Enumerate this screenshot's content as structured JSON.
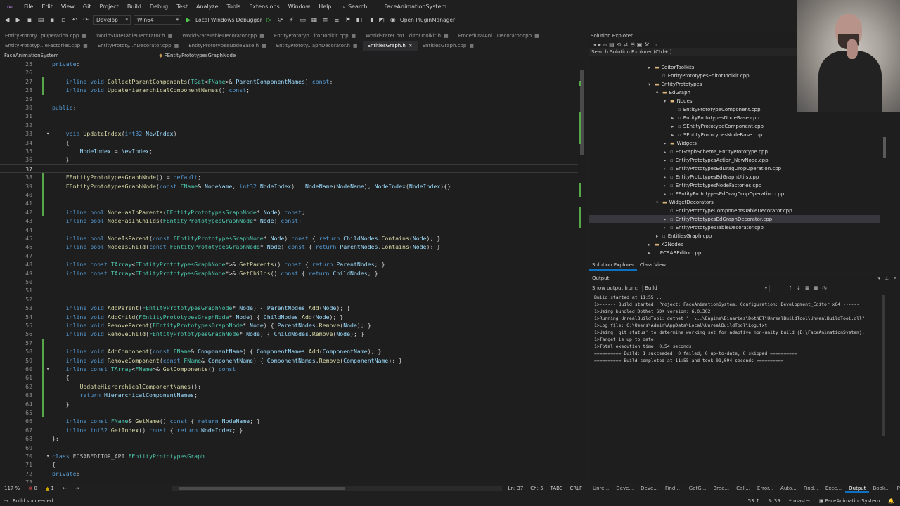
{
  "menu": {
    "items": [
      "File",
      "Edit",
      "View",
      "Git",
      "Project",
      "Build",
      "Debug",
      "Test",
      "Analyze",
      "Tools",
      "Extensions",
      "Window",
      "Help"
    ],
    "search_label": "Search",
    "app_title": "FaceAnimationSystem"
  },
  "toolbar": {
    "config": "Develop",
    "platform": "Win64",
    "debugger": "Local Windows Debugger",
    "plugin_manager": "Open PluginManager"
  },
  "tabs": {
    "row1": [
      {
        "label": "EntityPrototy...pOperation.cpp",
        "active": false
      },
      {
        "label": "WorldStateTableDecorator.h",
        "active": false
      },
      {
        "label": "WorldStateTableDecorator.cpp",
        "active": false
      },
      {
        "label": "EntityPrototyp...itorToolkit.cpp",
        "active": false
      },
      {
        "label": "WorldStateCont...ditorToolkit.h",
        "active": false
      },
      {
        "label": "ProceduralAni...Decorator.cpp",
        "active": false
      }
    ],
    "row2": [
      {
        "label": "EntityPrototyp...eFactories.cpp",
        "active": false
      },
      {
        "label": "EntityPrototy...hDecorator.cpp",
        "active": false
      },
      {
        "label": "EntityPrototypesNodeBase.h",
        "active": false
      },
      {
        "label": "EntityPrototy...aphDecorator.h",
        "active": false
      },
      {
        "label": "EntitiesGraph.h",
        "active": true
      },
      {
        "label": "EntitiesGraph.cpp",
        "active": false
      }
    ]
  },
  "navbar": {
    "project": "FaceAnimationSystem",
    "scope": "FEntityPrototypesGraphNode"
  },
  "code": {
    "lines": [
      {
        "n": "25",
        "t": "private:"
      },
      {
        "n": "26",
        "t": ""
      },
      {
        "n": "27",
        "t": "    inline void CollectParentComponents(TSet<FName>& ParentComponentNames) const;"
      },
      {
        "n": "28",
        "t": "    inline void UpdateHierarchicalComponentNames() const;"
      },
      {
        "n": "29",
        "t": ""
      },
      {
        "n": "30",
        "t": "public:"
      },
      {
        "n": "31",
        "t": ""
      },
      {
        "n": "32",
        "t": ""
      },
      {
        "n": "33",
        "t": "    void UpdateIndex(int32 NewIndex)"
      },
      {
        "n": "34",
        "t": "    {"
      },
      {
        "n": "35",
        "t": "        NodeIndex = NewIndex;"
      },
      {
        "n": "36",
        "t": "    }"
      },
      {
        "n": "37",
        "t": ""
      },
      {
        "n": "38",
        "t": "    FEntityPrototypesGraphNode() = default;"
      },
      {
        "n": "39",
        "t": "    FEntityPrototypesGraphNode(const FName& NodeName, int32 NodeIndex) : NodeName(NodeName), NodeIndex(NodeIndex){}"
      },
      {
        "n": "40",
        "t": ""
      },
      {
        "n": "41",
        "t": ""
      },
      {
        "n": "42",
        "t": "    inline bool NodeHasInParents(FEntityPrototypesGraphNode* Node) const;"
      },
      {
        "n": "43",
        "t": "    inline bool NodeHasInChilds(FEntityPrototypesGraphNode* Node) const;"
      },
      {
        "n": "44",
        "t": ""
      },
      {
        "n": "45",
        "t": "    inline bool NodeIsParent(const FEntityPrototypesGraphNode* Node) const { return ChildNodes.Contains(Node); }"
      },
      {
        "n": "46",
        "t": "    inline bool NodeIsChild(const FEntityPrototypesGraphNode* Node) const { return ParentNodes.Contains(Node); }"
      },
      {
        "n": "47",
        "t": ""
      },
      {
        "n": "48",
        "t": "    inline const TArray<FEntityPrototypesGraphNode*>& GetParents() const { return ParentNodes; }"
      },
      {
        "n": "49",
        "t": "    inline const TArray<FEntityPrototypesGraphNode*>& GetChilds() const { return ChildNodes; }"
      },
      {
        "n": "50",
        "t": ""
      },
      {
        "n": "51",
        "t": ""
      },
      {
        "n": "52",
        "t": ""
      },
      {
        "n": "53",
        "t": "    inline void AddParent(FEntityPrototypesGraphNode* Node) { ParentNodes.Add(Node); }"
      },
      {
        "n": "54",
        "t": "    inline void AddChild(FEntityPrototypesGraphNode* Node) { ChildNodes.Add(Node); }"
      },
      {
        "n": "55",
        "t": "    inline void RemoveParent(FEntityPrototypesGraphNode* Node) { ParentNodes.Remove(Node); }"
      },
      {
        "n": "56",
        "t": "    inline void RemoveChild(FEntityPrototypesGraphNode* Node) { ChildNodes.Remove(Node); }"
      },
      {
        "n": "57",
        "t": ""
      },
      {
        "n": "58",
        "t": "    inline void AddComponent(const FName& ComponentName) { ComponentNames.Add(ComponentName); }"
      },
      {
        "n": "59",
        "t": "    inline void RemoveComponent(const FName& ComponentName) { ComponentNames.Remove(ComponentName); }"
      },
      {
        "n": "60",
        "t": "    inline const TArray<FName>& GetComponents() const"
      },
      {
        "n": "61",
        "t": "    {"
      },
      {
        "n": "62",
        "t": "        UpdateHierarchicalComponentNames();"
      },
      {
        "n": "63",
        "t": "        return HierarchicalComponentNames;"
      },
      {
        "n": "64",
        "t": "    }"
      },
      {
        "n": "65",
        "t": ""
      },
      {
        "n": "66",
        "t": "    inline const FName& GetName() const { return NodeName; }"
      },
      {
        "n": "67",
        "t": "    inline int32 GetIndex() const { return NodeIndex; }"
      },
      {
        "n": "68",
        "t": "};"
      },
      {
        "n": "69",
        "t": ""
      },
      {
        "n": "70",
        "t": "class ECSABEDITOR_API FEntityPrototypesGraph"
      },
      {
        "n": "71",
        "t": "{"
      },
      {
        "n": "72",
        "t": "private:"
      },
      {
        "n": "73",
        "t": ""
      }
    ]
  },
  "editor_status": {
    "zoom": "117 %",
    "errors": "0",
    "warnings": "1",
    "line": "Ln: 37",
    "col": "Ch: 5",
    "tabs": "TABS",
    "eol": "CRLF"
  },
  "solution_explorer": {
    "title": "Solution Explorer",
    "search_placeholder": "Search Solution Explorer (Ctrl+;)",
    "items": [
      {
        "label": "EditorToolkits",
        "kind": "folder",
        "level": 4,
        "arrow": "▸"
      },
      {
        "label": "EntityPrototypesEditorToolkit.cpp",
        "kind": "cpp",
        "level": 5,
        "arrow": ""
      },
      {
        "label": "EntityPrototypes",
        "kind": "folder",
        "level": 4,
        "arrow": "▾"
      },
      {
        "label": "EdGraph",
        "kind": "folder",
        "level": 5,
        "arrow": "▾"
      },
      {
        "label": "Nodes",
        "kind": "folder",
        "level": 6,
        "arrow": "▾"
      },
      {
        "label": "EntityPrototypeComponent.cpp",
        "kind": "cpp",
        "level": 7,
        "arrow": ""
      },
      {
        "label": "EntityPrototypesNodeBase.cpp",
        "kind": "cpp",
        "level": 7,
        "arrow": "▸"
      },
      {
        "label": "SEntityPrototypeComponent.cpp",
        "kind": "cpp",
        "level": 7,
        "arrow": "▸"
      },
      {
        "label": "SEntityPrototypesNodeBase.cpp",
        "kind": "cpp",
        "level": 7,
        "arrow": "▸"
      },
      {
        "label": "Widgets",
        "kind": "folder",
        "level": 6,
        "arrow": "▸"
      },
      {
        "label": "EdGraphSchema_EntityPrototype.cpp",
        "kind": "cpp",
        "level": 6,
        "arrow": "▸"
      },
      {
        "label": "EntityPrototypesAction_NewNode.cpp",
        "kind": "cpp",
        "level": 6,
        "arrow": "▸"
      },
      {
        "label": "EntityPrototypesEdDragDropOperation.cpp",
        "kind": "cpp",
        "level": 6,
        "arrow": "▸"
      },
      {
        "label": "EntityPrototypesEdGraphUtils.cpp",
        "kind": "cpp",
        "level": 6,
        "arrow": "▸"
      },
      {
        "label": "EntityPrototypesNodeFactories.cpp",
        "kind": "cpp",
        "level": 6,
        "arrow": "▸"
      },
      {
        "label": "FEntityPrototypesEdDragDropOperation.cpp",
        "kind": "cpp",
        "level": 6,
        "arrow": "▸"
      },
      {
        "label": "WidgetDecorators",
        "kind": "folder",
        "level": 5,
        "arrow": "▾"
      },
      {
        "label": "EntityPrototypeComponentsTableDecorator.cpp",
        "kind": "cpp",
        "level": 6,
        "arrow": ""
      },
      {
        "label": "EntityPrototypesEdGraphDecorator.cpp",
        "kind": "cpp",
        "level": 6,
        "arrow": "▸",
        "selected": true
      },
      {
        "label": "EntityPrototypesTableDecorator.cpp",
        "kind": "cpp",
        "level": 6,
        "arrow": "▸"
      },
      {
        "label": "EntitiesGraph.cpp",
        "kind": "cpp",
        "level": 5,
        "arrow": "▸"
      },
      {
        "label": "K2Nodes",
        "kind": "folder",
        "level": 4,
        "arrow": "▸"
      },
      {
        "label": "ECSABEditor.cpp",
        "kind": "cpp",
        "level": 4,
        "arrow": "▸"
      }
    ],
    "tabs": [
      "Solution Explorer",
      "Class View"
    ]
  },
  "output": {
    "title": "Output",
    "show_label": "Show output from:",
    "source": "Build",
    "lines": [
      "Build started at 11:55...",
      "1>------ Build started: Project: FaceAnimationSystem, Configuration: Development_Editor x64 ------",
      "1>Using bundled DotNet SDK version: 6.0.302",
      "1>Running UnrealBuildTool: dotnet \"..\\..\\Engine\\Binaries\\DotNET\\UnrealBuildTool\\UnrealBuildTool.dll\"",
      "1>Log file: C:\\Users\\Admin\\AppData\\Local\\UnrealBuildTool\\Log.txt",
      "1>Using 'git status' to determine working set for adaptive non-unity build (E:\\FaceAnimationSystem).",
      "1>Target is up to date",
      "1>Total execution time: 0.54 seconds",
      "========== Build: 1 succeeded, 0 failed, 0 up-to-date, 0 skipped ==========",
      "========== Build completed at 11:55 and took 01,094 seconds =========="
    ]
  },
  "bottom_tabs": [
    {
      "label": "Unre...",
      "active": false
    },
    {
      "label": "Deve...",
      "active": false
    },
    {
      "label": "Deve...",
      "active": false
    },
    {
      "label": "Find...",
      "active": false
    },
    {
      "label": "!GetG...",
      "active": false
    },
    {
      "label": "Brea...",
      "active": false
    },
    {
      "label": "Call...",
      "active": false
    },
    {
      "label": "Error...",
      "active": false
    },
    {
      "label": "Auto...",
      "active": false
    },
    {
      "label": "Find...",
      "active": false
    },
    {
      "label": "Exce...",
      "active": false
    },
    {
      "label": "Output",
      "active": true
    },
    {
      "label": "Book...",
      "active": false
    },
    {
      "label": "Prop...",
      "active": false
    }
  ],
  "statusbar": {
    "message": "Build succeeded",
    "count1": "53",
    "count2": "39",
    "branch": "master",
    "repo": "FaceAnimationSystem"
  }
}
